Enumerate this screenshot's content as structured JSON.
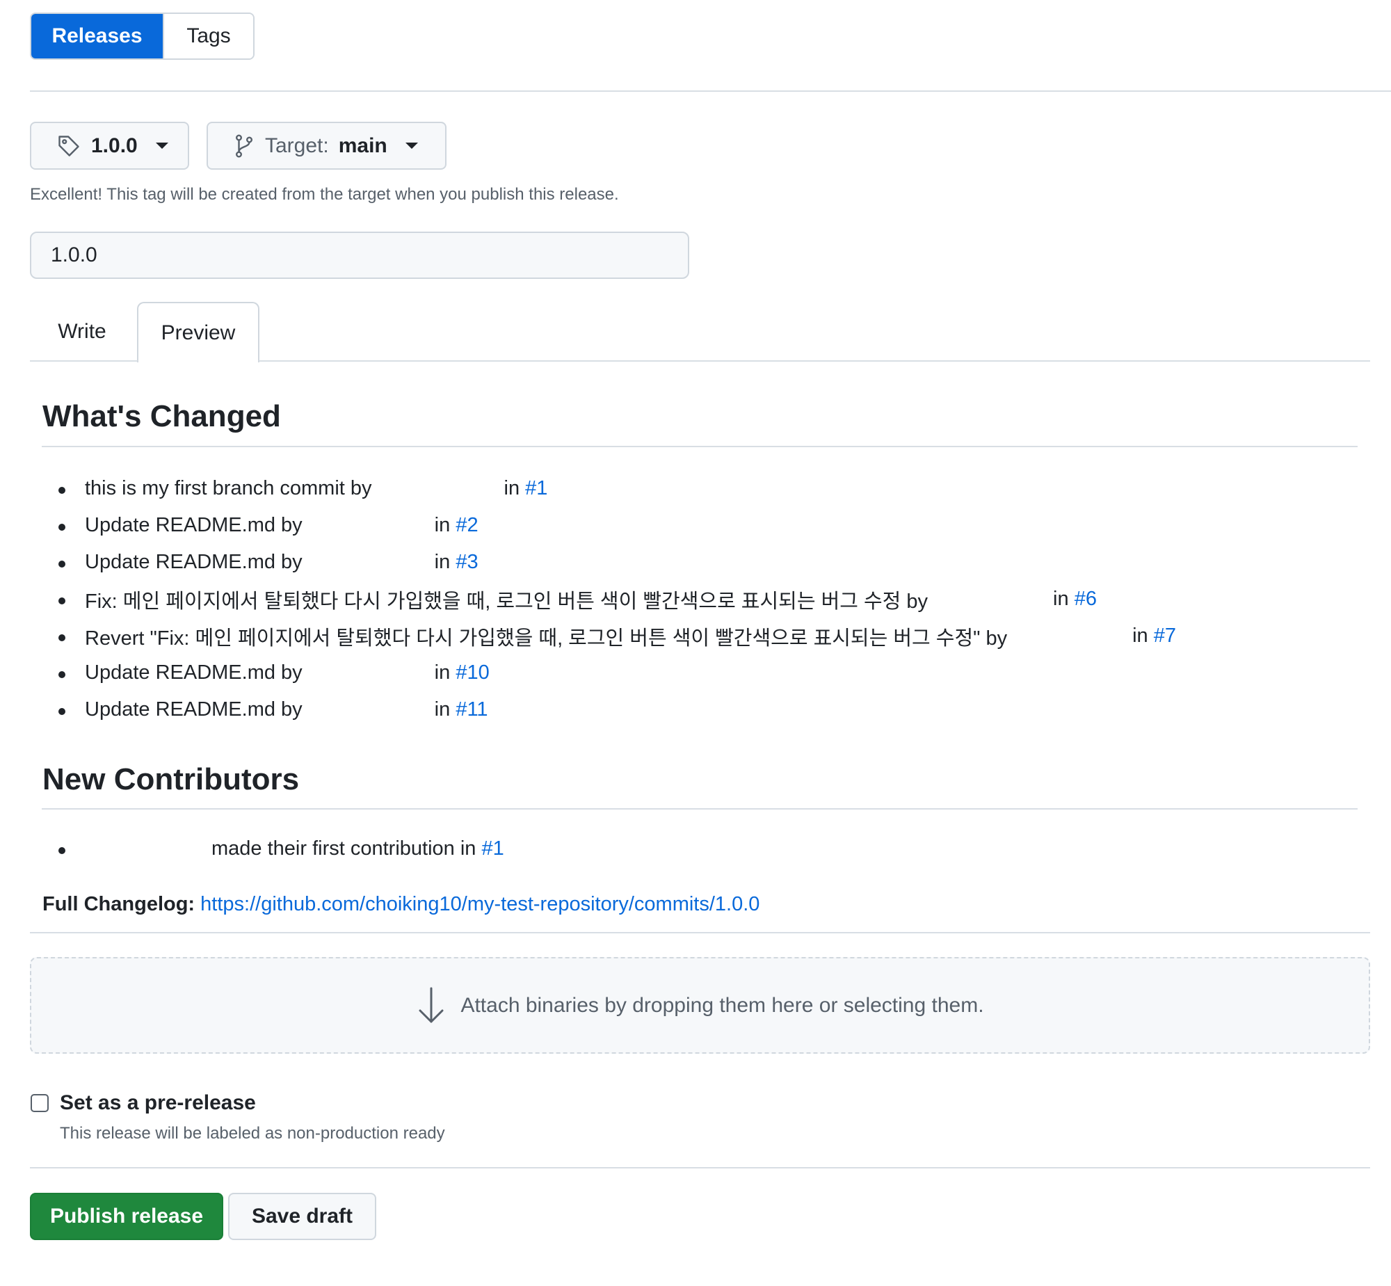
{
  "nav": {
    "releases": "Releases",
    "tags": "Tags"
  },
  "tag_button": {
    "icon": "tag-icon",
    "label": "1.0.0"
  },
  "target_button": {
    "icon": "git-branch-icon",
    "prefix": "Target:",
    "value": "main"
  },
  "tag_note": "Excellent! This tag will be created from the target when you publish this release.",
  "release_title": {
    "value": "1.0.0"
  },
  "editor_tabs": {
    "write": "Write",
    "preview": "Preview",
    "active": "Preview"
  },
  "preview": {
    "whats_changed": {
      "heading": "What's Changed",
      "items": [
        {
          "text": "this is my first branch commit by",
          "in": "in",
          "pr": "#1"
        },
        {
          "text": "Update README.md by",
          "in": "in",
          "pr": "#2"
        },
        {
          "text": "Update README.md by",
          "in": "in",
          "pr": "#3"
        },
        {
          "text": "Fix: 메인 페이지에서 탈퇴했다 다시 가입했을 때, 로그인 버튼 색이 빨간색으로 표시되는 버그 수정 by",
          "in": "in",
          "pr": "#6"
        },
        {
          "text": "Revert \"Fix: 메인 페이지에서 탈퇴했다 다시 가입했을 때, 로그인 버튼 색이 빨간색으로 표시되는 버그 수정\" by",
          "in": "in",
          "pr": "#7"
        },
        {
          "text": "Update README.md by",
          "in": "in",
          "pr": "#10"
        },
        {
          "text": "Update README.md by",
          "in": "in",
          "pr": "#11"
        }
      ]
    },
    "new_contributors": {
      "heading": "New Contributors",
      "items": [
        {
          "text": "made their first contribution in",
          "pr": "#1"
        }
      ]
    },
    "full_changelog": {
      "label": "Full Changelog:",
      "url": "https://github.com/choiking10/my-test-repository/commits/1.0.0"
    }
  },
  "attach": {
    "icon": "arrow-down-icon",
    "text": "Attach binaries by dropping them here or selecting them."
  },
  "prerelease": {
    "label": "Set as a pre-release",
    "hint": "This release will be labeled as non-production ready",
    "checked": false
  },
  "actions": {
    "publish": "Publish release",
    "save_draft": "Save draft"
  },
  "colors": {
    "primary": "#0969da",
    "publish": "#1f883d",
    "link": "#0969da",
    "border": "#d0d7de"
  }
}
